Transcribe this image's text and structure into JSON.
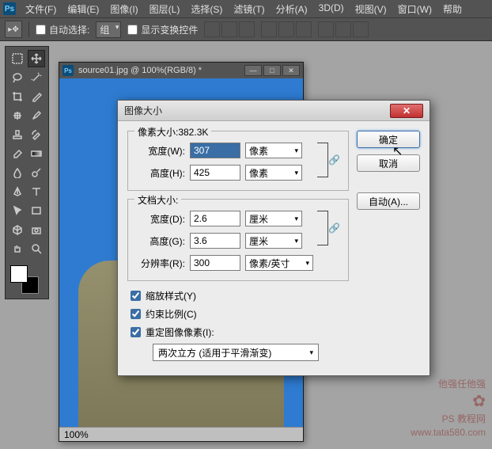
{
  "app": {
    "logo": "Ps"
  },
  "menu": [
    "文件(F)",
    "编辑(E)",
    "图像(I)",
    "图层(L)",
    "选择(S)",
    "滤镜(T)",
    "分析(A)",
    "3D(D)",
    "视图(V)",
    "窗口(W)",
    "帮助"
  ],
  "options": {
    "auto_select_label": "自动选择:",
    "auto_select_value": "组",
    "show_transform_label": "显示变换控件"
  },
  "document": {
    "title": "source01.jpg @ 100%(RGB/8) *",
    "zoom": "100%"
  },
  "dialog": {
    "title": "图像大小",
    "pixel_section_label": "像素大小:382.3K",
    "width_px_label": "宽度(W):",
    "width_px_value": "307",
    "height_px_label": "高度(H):",
    "height_px_value": "425",
    "unit_px": "像素",
    "doc_section_label": "文档大小:",
    "width_cm_label": "宽度(D):",
    "width_cm_value": "2.6",
    "height_cm_label": "高度(G):",
    "height_cm_value": "3.6",
    "unit_cm": "厘米",
    "res_label": "分辨率(R):",
    "res_value": "300",
    "res_unit": "像素/英寸",
    "scale_styles_label": "缩放样式(Y)",
    "constrain_label": "约束比例(C)",
    "resample_label": "重定图像像素(I):",
    "resample_method": "两次立方 (适用于平滑渐变)",
    "ok_label": "确定",
    "cancel_label": "取消",
    "auto_label": "自动(A)..."
  },
  "watermark": {
    "line1": "他强任他强",
    "line2": "PS 教程网",
    "line3": "www.tata580.com"
  }
}
